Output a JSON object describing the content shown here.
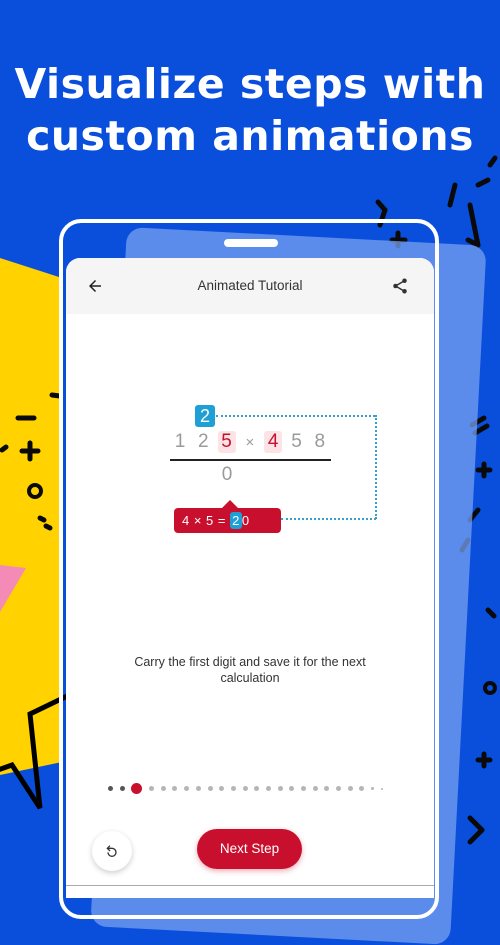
{
  "promo": {
    "headline_line1": "Visualize steps with",
    "headline_line2": "custom animations"
  },
  "colors": {
    "background_blue": "#0a4fdc",
    "yellow": "#ffd200",
    "pink": "#f48bb6",
    "accent_red": "#c8102e",
    "carry_blue": "#1ea0d6"
  },
  "app": {
    "appbar": {
      "title": "Animated Tutorial",
      "back_icon": "arrow-left-icon",
      "share_icon": "share-icon"
    },
    "problem": {
      "carry_digit": "2",
      "digits": [
        "1",
        "2",
        "5",
        "×",
        "4",
        "5",
        "8"
      ],
      "highlighted_indices": [
        2,
        4
      ],
      "result_digits": [
        "0"
      ],
      "tooltip": {
        "left": "4 × 5 = ",
        "carry": "2",
        "right": "0"
      }
    },
    "description": "Carry the first digit and save it for the next calculation",
    "progress": {
      "total_steps": 24,
      "current_step": 3,
      "completed_steps": 2
    },
    "buttons": {
      "undo_icon": "undo-icon",
      "next_label": "Next Step"
    }
  }
}
